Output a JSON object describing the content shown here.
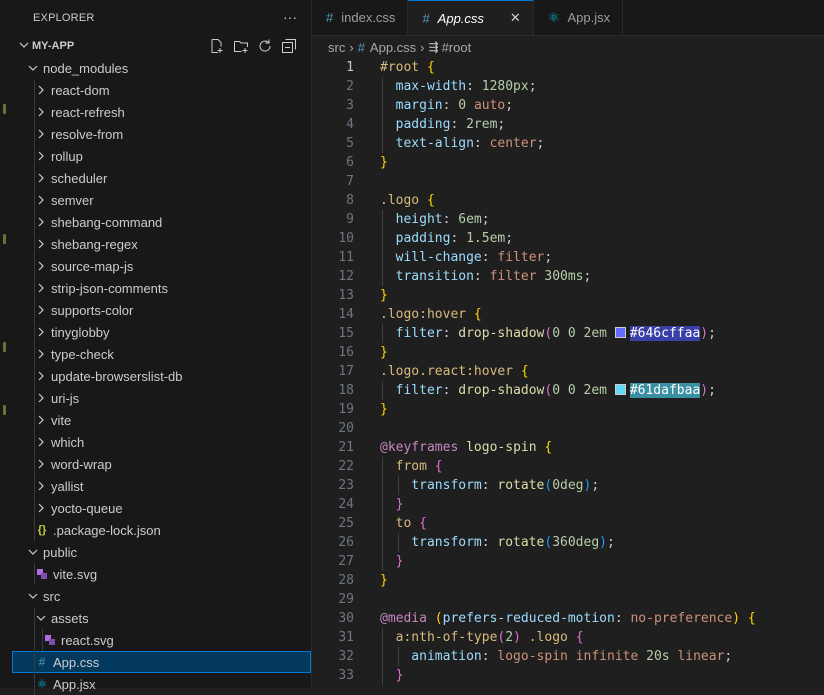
{
  "sidebar": {
    "header_title": "EXPLORER",
    "more_label": "···",
    "project_name": "MY-APP",
    "tree": [
      {
        "label": "node_modules",
        "type": "folder-open",
        "depth": 1
      },
      {
        "label": "react-dom",
        "type": "folder",
        "depth": 2
      },
      {
        "label": "react-refresh",
        "type": "folder",
        "depth": 2
      },
      {
        "label": "resolve-from",
        "type": "folder",
        "depth": 2
      },
      {
        "label": "rollup",
        "type": "folder",
        "depth": 2
      },
      {
        "label": "scheduler",
        "type": "folder",
        "depth": 2
      },
      {
        "label": "semver",
        "type": "folder",
        "depth": 2
      },
      {
        "label": "shebang-command",
        "type": "folder",
        "depth": 2
      },
      {
        "label": "shebang-regex",
        "type": "folder",
        "depth": 2
      },
      {
        "label": "source-map-js",
        "type": "folder",
        "depth": 2
      },
      {
        "label": "strip-json-comments",
        "type": "folder",
        "depth": 2
      },
      {
        "label": "supports-color",
        "type": "folder",
        "depth": 2
      },
      {
        "label": "tinyglobby",
        "type": "folder",
        "depth": 2
      },
      {
        "label": "type-check",
        "type": "folder",
        "depth": 2
      },
      {
        "label": "update-browserslist-db",
        "type": "folder",
        "depth": 2
      },
      {
        "label": "uri-js",
        "type": "folder",
        "depth": 2
      },
      {
        "label": "vite",
        "type": "folder",
        "depth": 2
      },
      {
        "label": "which",
        "type": "folder",
        "depth": 2
      },
      {
        "label": "word-wrap",
        "type": "folder",
        "depth": 2
      },
      {
        "label": "yallist",
        "type": "folder",
        "depth": 2
      },
      {
        "label": "yocto-queue",
        "type": "folder",
        "depth": 2
      },
      {
        "label": ".package-lock.json",
        "type": "json",
        "depth": 2
      },
      {
        "label": "public",
        "type": "folder-open",
        "depth": 1
      },
      {
        "label": "vite.svg",
        "type": "svg",
        "depth": 2
      },
      {
        "label": "src",
        "type": "folder-open",
        "depth": 1
      },
      {
        "label": "assets",
        "type": "folder-open",
        "depth": 2
      },
      {
        "label": "react.svg",
        "type": "svg",
        "depth": 3
      },
      {
        "label": "App.css",
        "type": "css",
        "depth": 2,
        "selected": true
      },
      {
        "label": "App.jsx",
        "type": "jsx",
        "depth": 2
      }
    ]
  },
  "tabs": [
    {
      "label": "index.css",
      "icon": "css-hash-icon",
      "active": false
    },
    {
      "label": "App.css",
      "icon": "css-hash-icon",
      "active": true
    },
    {
      "label": "App.jsx",
      "icon": "react-icon",
      "active": false
    }
  ],
  "tab_close": "✕",
  "breadcrumb": {
    "folder": "src",
    "file": "App.css",
    "symbol": "#root"
  },
  "editor": {
    "current_line": 1,
    "lines": [
      [
        [
          "#root",
          "sel"
        ],
        [
          " ",
          ""
        ],
        [
          "{",
          "br1"
        ]
      ],
      [
        [
          "  max-width",
          "prop"
        ],
        [
          ": ",
          ""
        ],
        [
          "1280px",
          "num"
        ],
        [
          ";",
          ""
        ]
      ],
      [
        [
          "  margin",
          "prop"
        ],
        [
          ": ",
          ""
        ],
        [
          "0",
          "num"
        ],
        [
          " ",
          ""
        ],
        [
          "auto",
          "val"
        ],
        [
          ";",
          ""
        ]
      ],
      [
        [
          "  padding",
          "prop"
        ],
        [
          ": ",
          ""
        ],
        [
          "2rem",
          "num"
        ],
        [
          ";",
          ""
        ]
      ],
      [
        [
          "  text-align",
          "prop"
        ],
        [
          ": ",
          ""
        ],
        [
          "center",
          "val"
        ],
        [
          ";",
          ""
        ]
      ],
      [
        [
          "}",
          "br1"
        ]
      ],
      [],
      [
        [
          ".logo",
          "sel"
        ],
        [
          " ",
          ""
        ],
        [
          "{",
          "br1"
        ]
      ],
      [
        [
          "  height",
          "prop"
        ],
        [
          ": ",
          ""
        ],
        [
          "6em",
          "num"
        ],
        [
          ";",
          ""
        ]
      ],
      [
        [
          "  padding",
          "prop"
        ],
        [
          ": ",
          ""
        ],
        [
          "1.5em",
          "num"
        ],
        [
          ";",
          ""
        ]
      ],
      [
        [
          "  will-change",
          "prop"
        ],
        [
          ": ",
          ""
        ],
        [
          "filter",
          "val"
        ],
        [
          ";",
          ""
        ]
      ],
      [
        [
          "  transition",
          "prop"
        ],
        [
          ": ",
          ""
        ],
        [
          "filter",
          "val"
        ],
        [
          " ",
          ""
        ],
        [
          "300ms",
          "num"
        ],
        [
          ";",
          ""
        ]
      ],
      [
        [
          "}",
          "br1"
        ]
      ],
      [
        [
          ".logo:hover",
          "sel"
        ],
        [
          " ",
          ""
        ],
        [
          "{",
          "br1"
        ]
      ],
      [
        [
          "  filter",
          "prop"
        ],
        [
          ": ",
          ""
        ],
        [
          "drop-shadow",
          "fn"
        ],
        [
          "(",
          "br2"
        ],
        [
          "0",
          "num"
        ],
        [
          " ",
          ""
        ],
        [
          "0",
          "num"
        ],
        [
          " ",
          ""
        ],
        [
          "2em",
          "num"
        ],
        [
          " ",
          ""
        ],
        [
          "SWATCH:#646cff",
          "swatch"
        ],
        [
          "#646cffaa",
          "hl1"
        ],
        [
          ")",
          "br2"
        ],
        [
          ";",
          ""
        ]
      ],
      [
        [
          "}",
          "br1"
        ]
      ],
      [
        [
          ".logo.react:hover",
          "sel"
        ],
        [
          " ",
          ""
        ],
        [
          "{",
          "br1"
        ]
      ],
      [
        [
          "  filter",
          "prop"
        ],
        [
          ": ",
          ""
        ],
        [
          "drop-shadow",
          "fn"
        ],
        [
          "(",
          "br2"
        ],
        [
          "0",
          "num"
        ],
        [
          " ",
          ""
        ],
        [
          "0",
          "num"
        ],
        [
          " ",
          ""
        ],
        [
          "2em",
          "num"
        ],
        [
          " ",
          ""
        ],
        [
          "SWATCH:#61dafb",
          "swatch"
        ],
        [
          "#61dafbaa",
          "hl2"
        ],
        [
          ")",
          "br2"
        ],
        [
          ";",
          ""
        ]
      ],
      [
        [
          "}",
          "br1"
        ]
      ],
      [],
      [
        [
          "@keyframes",
          "kw"
        ],
        [
          " ",
          ""
        ],
        [
          "logo-spin",
          "fn"
        ],
        [
          " ",
          ""
        ],
        [
          "{",
          "br1"
        ]
      ],
      [
        [
          "  from",
          "sel"
        ],
        [
          " ",
          ""
        ],
        [
          "{",
          "br2"
        ]
      ],
      [
        [
          "    transform",
          "prop"
        ],
        [
          ": ",
          ""
        ],
        [
          "rotate",
          "fn"
        ],
        [
          "(",
          "br3"
        ],
        [
          "0deg",
          "num"
        ],
        [
          ")",
          "br3"
        ],
        [
          ";",
          ""
        ]
      ],
      [
        [
          "  }",
          "br2"
        ]
      ],
      [
        [
          "  to",
          "sel"
        ],
        [
          " ",
          ""
        ],
        [
          "{",
          "br2"
        ]
      ],
      [
        [
          "    transform",
          "prop"
        ],
        [
          ": ",
          ""
        ],
        [
          "rotate",
          "fn"
        ],
        [
          "(",
          "br3"
        ],
        [
          "360deg",
          "num"
        ],
        [
          ")",
          "br3"
        ],
        [
          ";",
          ""
        ]
      ],
      [
        [
          "  }",
          "br2"
        ]
      ],
      [
        [
          "}",
          "br1"
        ]
      ],
      [],
      [
        [
          "@media",
          "kw"
        ],
        [
          " ",
          ""
        ],
        [
          "(",
          "br1"
        ],
        [
          "prefers-reduced-motion",
          "prop"
        ],
        [
          ": ",
          ""
        ],
        [
          "no-preference",
          "val"
        ],
        [
          ")",
          "br1"
        ],
        [
          " ",
          ""
        ],
        [
          "{",
          "br1"
        ]
      ],
      [
        [
          "  a:nth-of-type",
          "sel"
        ],
        [
          "(",
          "br2"
        ],
        [
          "2",
          "num"
        ],
        [
          ")",
          "br2"
        ],
        [
          " ",
          ""
        ],
        [
          ".logo",
          "sel"
        ],
        [
          " ",
          ""
        ],
        [
          "{",
          "br2"
        ]
      ],
      [
        [
          "    animation",
          "prop"
        ],
        [
          ": ",
          ""
        ],
        [
          "logo-spin",
          "val"
        ],
        [
          " ",
          ""
        ],
        [
          "infinite",
          "val"
        ],
        [
          " ",
          ""
        ],
        [
          "20s",
          "num"
        ],
        [
          " ",
          ""
        ],
        [
          "linear",
          "val"
        ],
        [
          ";",
          ""
        ]
      ],
      [
        [
          "  }",
          "br2"
        ]
      ]
    ]
  },
  "colors": {
    "accent": "#0078d4",
    "css_icon": "#519aba",
    "react_icon": "#00b8d8",
    "json_icon": "#cbcb41",
    "svg_icon": "#b36ae2"
  }
}
